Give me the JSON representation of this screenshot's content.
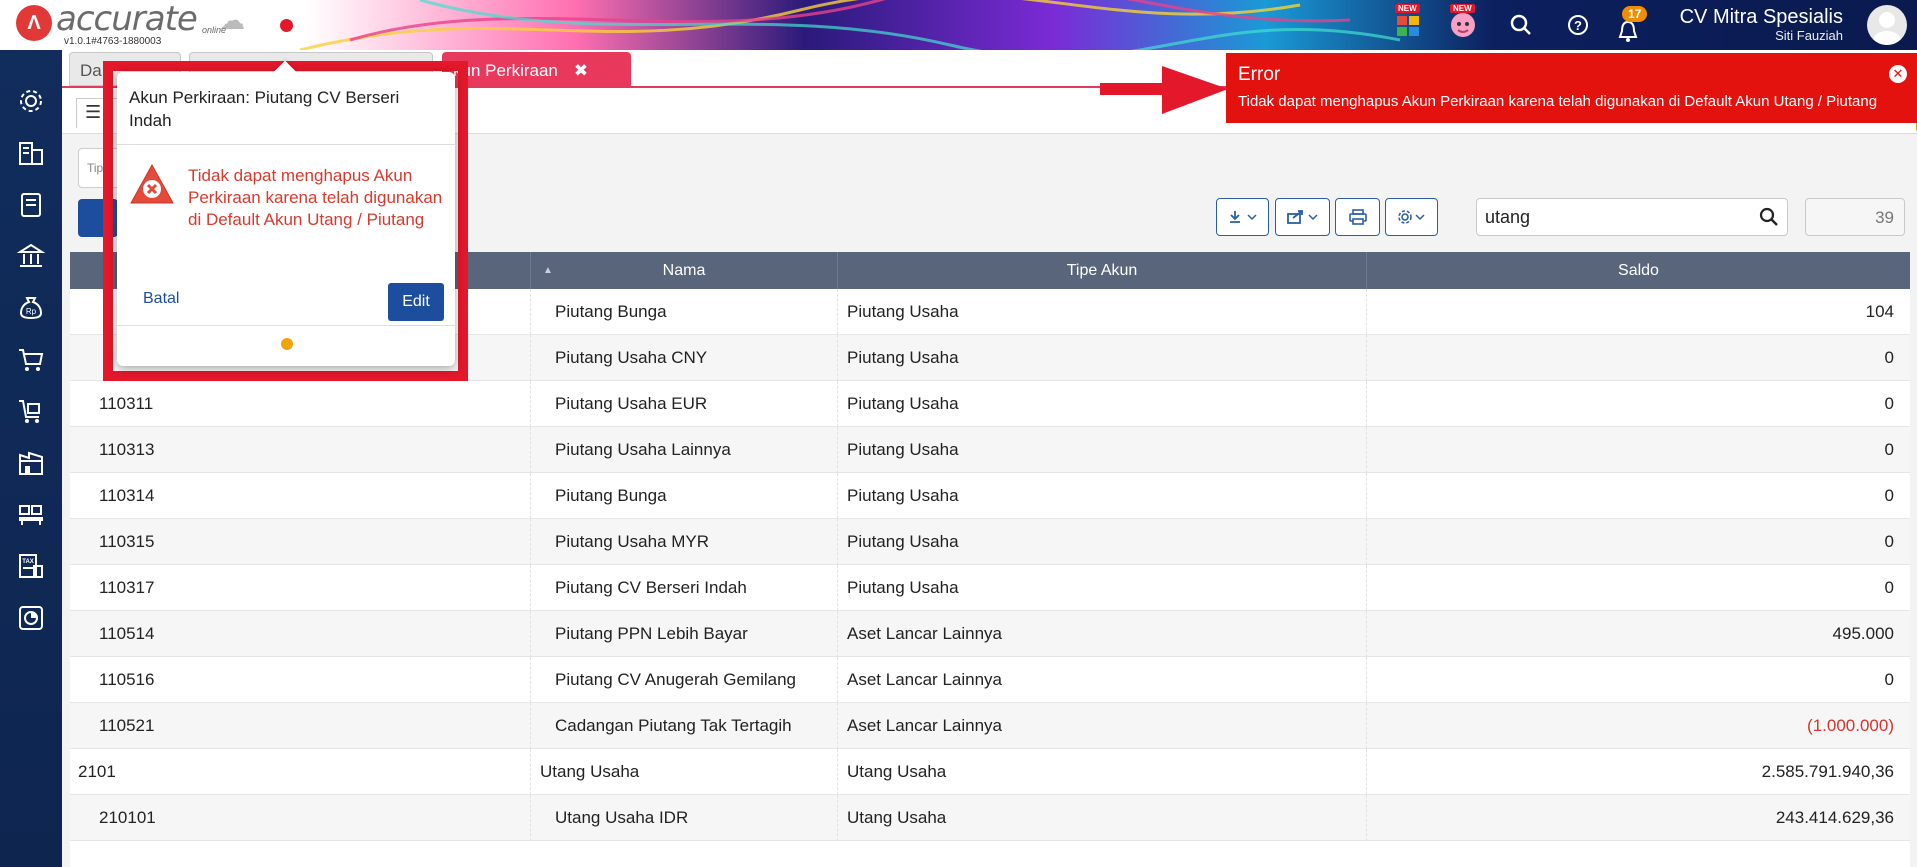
{
  "app": {
    "logo_text": "accurate",
    "logo_sub": "online",
    "version": "v1.0.1#4763-1880003",
    "new_badge": "NEW",
    "notification_count": "17",
    "company_name": "CV Mitra Spesialis",
    "user_name": "Siti Fauziah"
  },
  "tabs": [
    {
      "label": "Da"
    },
    {
      "label": ""
    },
    {
      "label": "kun Perkiraan",
      "close": "✖"
    }
  ],
  "filter": {
    "placeholder": "Tip"
  },
  "search": {
    "value": "utang"
  },
  "record_count": "39",
  "table": {
    "columns": [
      "",
      "Nama",
      "Tipe Akun",
      "Saldo"
    ],
    "rows": [
      {
        "no": "",
        "name": "Piutang Bunga",
        "type": "Piutang Usaha",
        "saldo": "104",
        "level": 2
      },
      {
        "no": "",
        "name": "Piutang Usaha CNY",
        "type": "Piutang Usaha",
        "saldo": "0",
        "level": 2
      },
      {
        "no": "110311",
        "name": "Piutang Usaha EUR",
        "type": "Piutang Usaha",
        "saldo": "0",
        "level": 2
      },
      {
        "no": "110313",
        "name": "Piutang Usaha Lainnya",
        "type": "Piutang Usaha",
        "saldo": "0",
        "level": 2
      },
      {
        "no": "110314",
        "name": "Piutang Bunga",
        "type": "Piutang Usaha",
        "saldo": "0",
        "level": 2
      },
      {
        "no": "110315",
        "name": "Piutang Usaha MYR",
        "type": "Piutang Usaha",
        "saldo": "0",
        "level": 2
      },
      {
        "no": "110317",
        "name": "Piutang CV Berseri Indah",
        "type": "Piutang Usaha",
        "saldo": "0",
        "level": 2
      },
      {
        "no": "110514",
        "name": "Piutang PPN Lebih Bayar",
        "type": "Aset Lancar Lainnya",
        "saldo": "495.000",
        "level": 2
      },
      {
        "no": "110516",
        "name": "Piutang CV Anugerah Gemilang",
        "type": "Aset Lancar Lainnya",
        "saldo": "0",
        "level": 2
      },
      {
        "no": "110521",
        "name": "Cadangan Piutang Tak Tertagih",
        "type": "Aset Lancar Lainnya",
        "saldo": "(1.000.000)",
        "level": 2,
        "negative": true
      },
      {
        "no": "2101",
        "name": "Utang Usaha",
        "type": "Utang Usaha",
        "saldo": "2.585.791.940,36",
        "level": 1
      },
      {
        "no": "210101",
        "name": "Utang Usaha IDR",
        "type": "Utang Usaha",
        "saldo": "243.414.629,36",
        "level": 2
      }
    ]
  },
  "popup": {
    "title": "Akun Perkiraan: Piutang CV Berseri Indah",
    "message": "Tidak dapat menghapus Akun Perkiraan karena telah digunakan di Default Akun Utang / Piutang",
    "cancel_label": "Batal",
    "edit_label": "Edit"
  },
  "error_toast": {
    "title": "Error",
    "message": "Tidak dapat menghapus Akun Perkiraan karena telah digunakan di Default Akun Utang / Piutang"
  },
  "colors": {
    "sidebar": "#112d5c",
    "active_tab": "#e8395d",
    "error": "#e3120f",
    "primary": "#1d4e9e",
    "header": "#59657b"
  }
}
